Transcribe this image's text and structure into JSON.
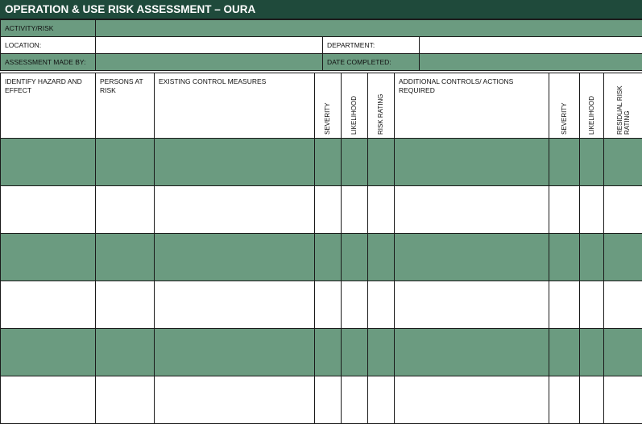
{
  "title": "OPERATION & USE RISK ASSESSMENT – OURA",
  "info": {
    "activity_label": "ACTIVITY/RISK",
    "location_label": "LOCATION:",
    "department_label": "DEPARTMENT:",
    "assessor_label": "ASSESSMENT MADE BY:",
    "date_label": "DATE COMPLETED:"
  },
  "columns": {
    "hazard": "IDENTIFY HAZARD AND EFFECT",
    "persons": "PERSONS AT RISK",
    "existing": "EXISTING CONTROL MEASURES",
    "severity": "SEVERITY",
    "likelihood": "LIKELIHOOD",
    "risk_rating": "RISK RATING",
    "additional": "ADDITIONAL CONTROLS/ ACTIONS REQUIRED",
    "severity2": "SEVERITY",
    "likelihood2": "LIKELIHOOD",
    "residual": "RESIDUAL RISK RATING"
  },
  "colors": {
    "title_bg": "#1f4a3b",
    "row_green": "#6b9b80",
    "row_white": "#ffffff"
  },
  "rows": [
    {
      "shade": "green"
    },
    {
      "shade": "white"
    },
    {
      "shade": "green"
    },
    {
      "shade": "white"
    },
    {
      "shade": "green"
    },
    {
      "shade": "white"
    }
  ]
}
